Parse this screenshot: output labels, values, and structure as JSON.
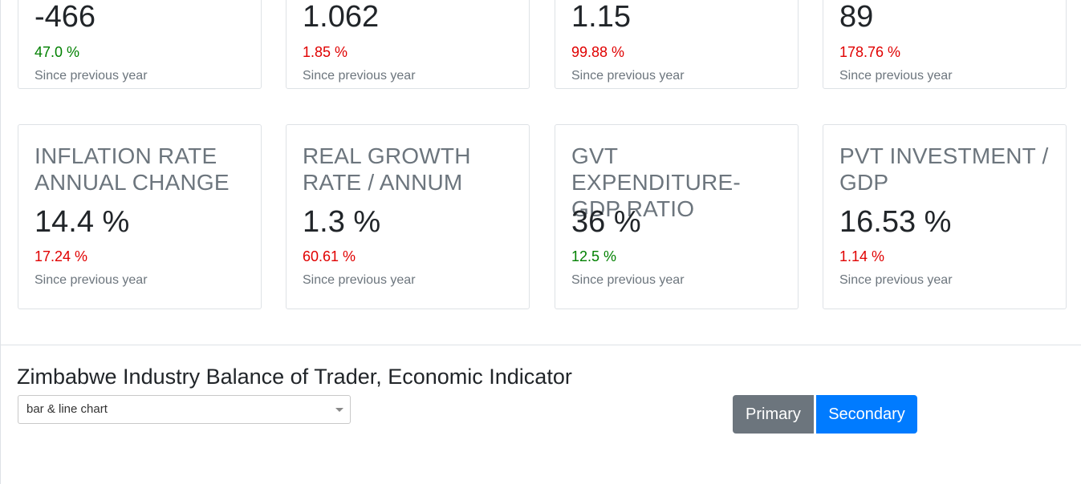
{
  "cards_row1": [
    {
      "value": "-466",
      "change": "47.0 %",
      "direction": "up",
      "since": "Since previous year"
    },
    {
      "value": "1.062",
      "change": "1.85 %",
      "direction": "down",
      "since": "Since previous year"
    },
    {
      "value": "1.15",
      "change": "99.88 %",
      "direction": "down",
      "since": "Since previous year"
    },
    {
      "value": "89",
      "change": "178.76 %",
      "direction": "down",
      "since": "Since previous year"
    }
  ],
  "cards_row2": [
    {
      "title": "INFLATION RATE ANNUAL CHANGE",
      "value": "14.4 %",
      "change": "17.24 %",
      "direction": "down",
      "since": "Since previous year"
    },
    {
      "title": "REAL GROWTH RATE / ANNUM",
      "value": "1.3 %",
      "change": "60.61 %",
      "direction": "down",
      "since": "Since previous year"
    },
    {
      "title": "GVT EXPENDITURE-GDP RATIO",
      "value": "36 %",
      "change": "12.5 %",
      "direction": "up",
      "since": "Since previous year"
    },
    {
      "title": "PVT INVESTMENT / GDP",
      "value": "16.53 %",
      "change": "1.14 %",
      "direction": "down",
      "since": "Since previous year"
    }
  ],
  "chart_section": {
    "title": "Zimbabwe Industry Balance of Trader, Economic Indicator",
    "chart_type_select": {
      "selected": "bar & line chart"
    },
    "primary_label": "Primary",
    "secondary_label": "Secondary"
  },
  "colors": {
    "up": "#008000",
    "down": "#e00000",
    "primary_button": "#6c757d",
    "secondary_button": "#007bff"
  }
}
